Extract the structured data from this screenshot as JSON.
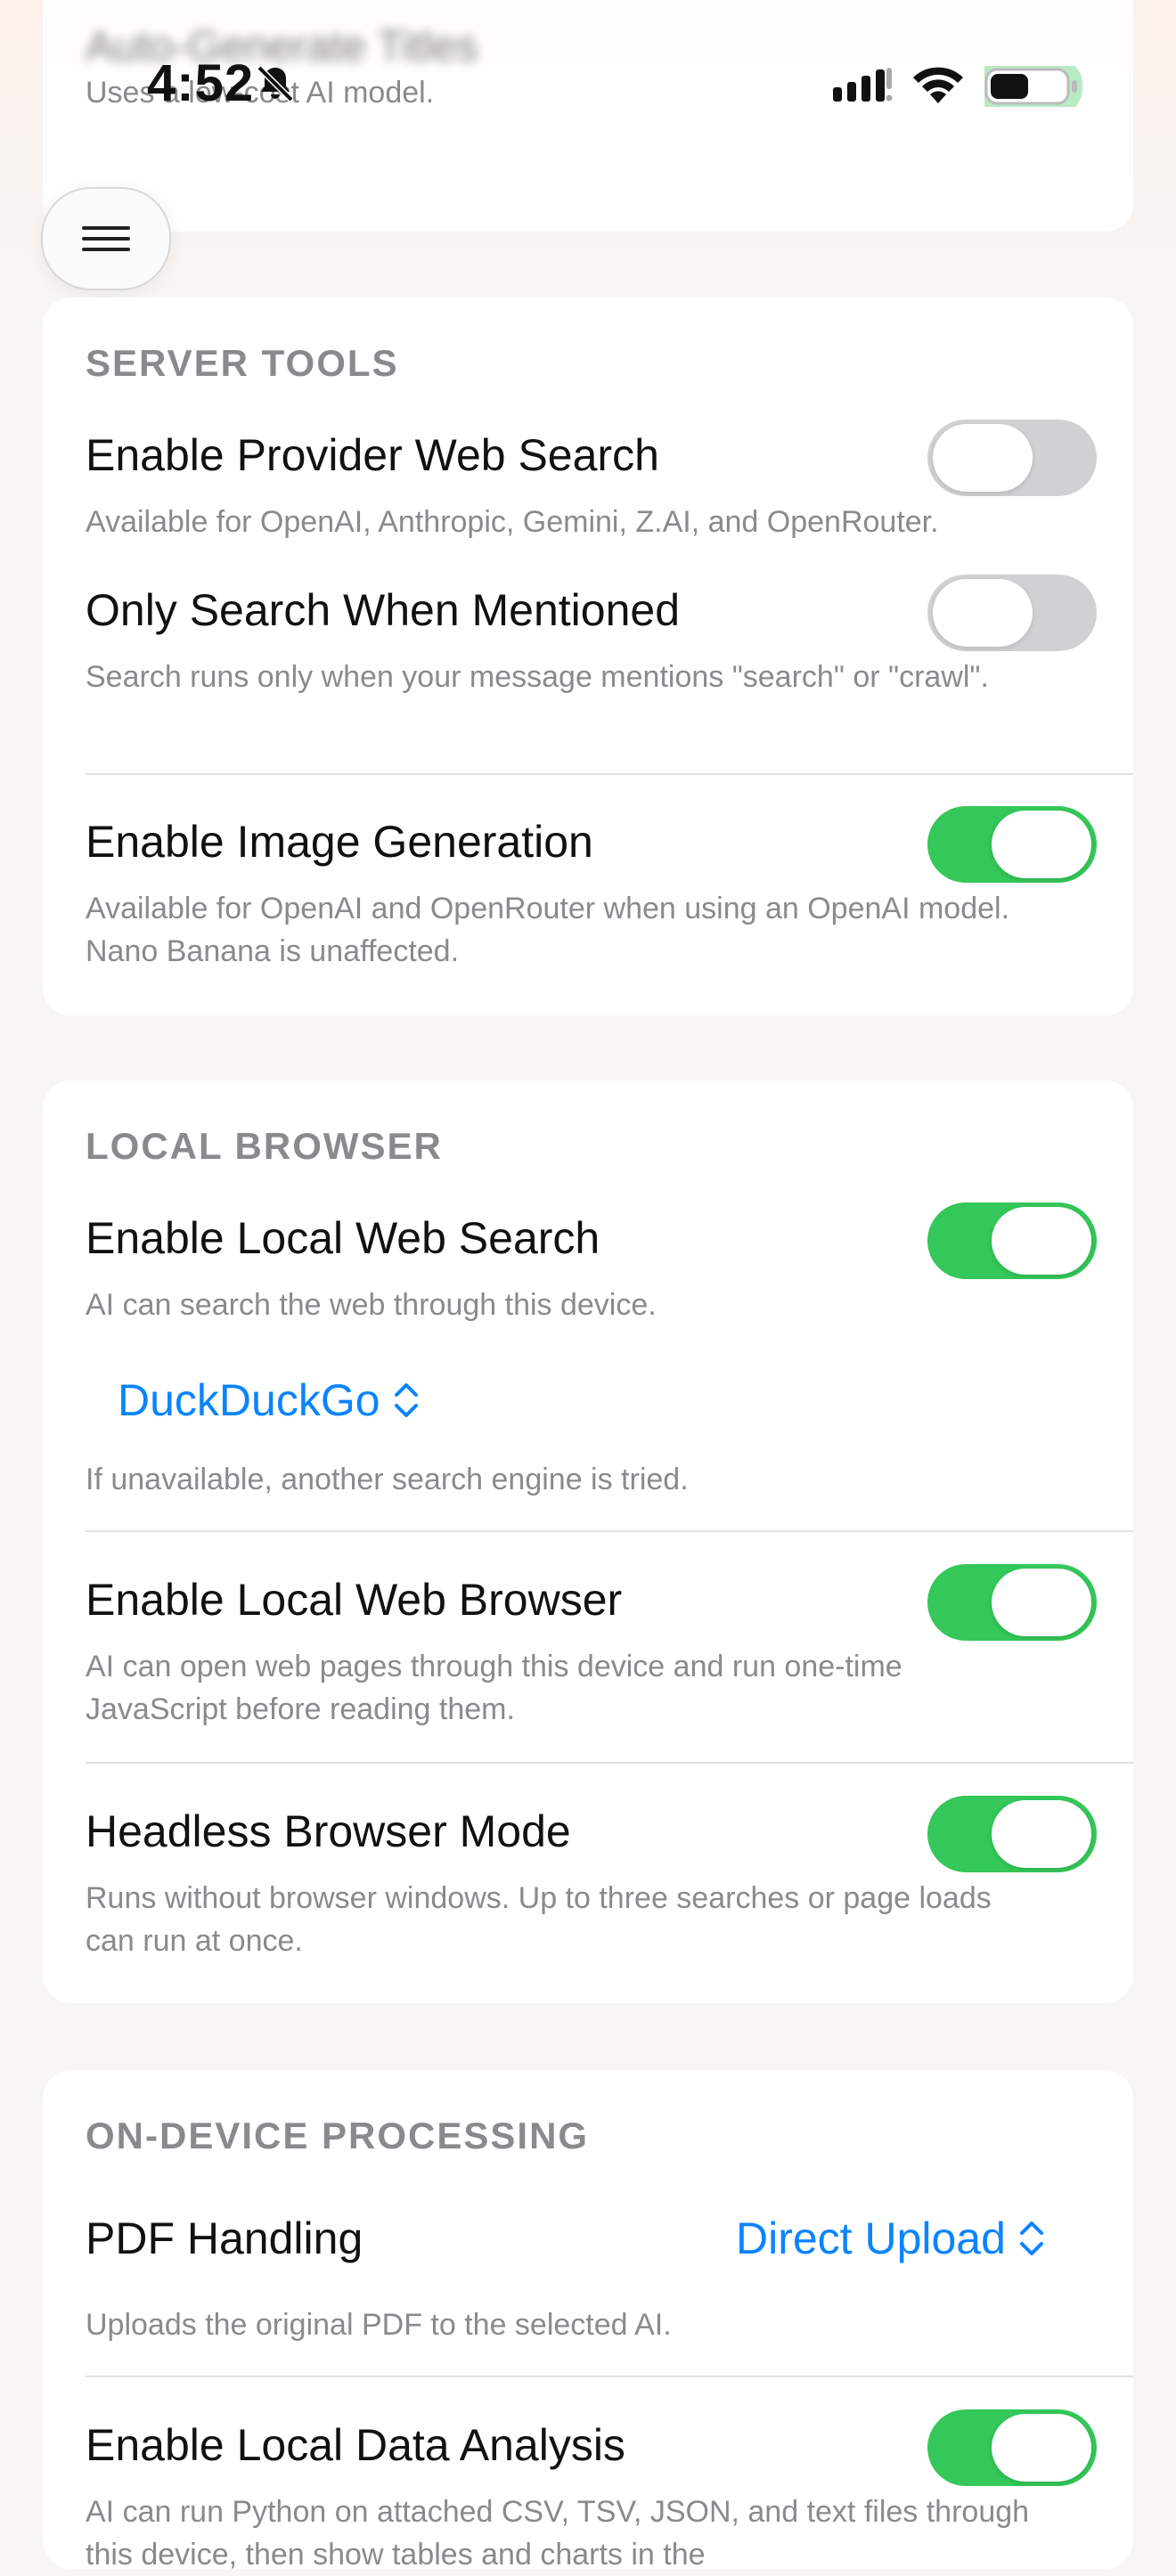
{
  "status_bar": {
    "time": "4:52"
  },
  "top_card": {
    "title": "Auto-Generate Titles",
    "note": "Uses a low-cost AI model."
  },
  "server_tools": {
    "title": "SERVER TOOLS",
    "rows": [
      {
        "title": "Enable Provider Web Search",
        "desc": "Available for OpenAI, Anthropic, Gemini, Z.AI, and OpenRouter.",
        "on": false
      },
      {
        "title": "Only Search When Mentioned",
        "desc": "Search runs only when your message mentions \"search\" or \"crawl\".",
        "on": false
      },
      {
        "title": "Enable Image Generation",
        "desc": "Available for OpenAI and OpenRouter when using an OpenAI model. Nano Banana is unaffected.",
        "on": true
      }
    ]
  },
  "local_browser": {
    "title": "LOCAL BROWSER",
    "search": {
      "title": "Enable Local Web Search",
      "desc": "AI can search the web through this device.",
      "on": true
    },
    "engine_picker": "DuckDuckGo",
    "engine_note": "If unavailable, another search engine is tried.",
    "browser": {
      "title": "Enable Local Web Browser",
      "desc": "AI can open web pages through this device and run one-time JavaScript before reading them.",
      "on": true
    },
    "headless": {
      "title": "Headless Browser Mode",
      "desc": "Runs without browser windows. Up to three searches or page loads can run at once.",
      "on": true
    }
  },
  "on_device": {
    "title": "ON-DEVICE PROCESSING",
    "pdf_label": "PDF Handling",
    "pdf_value": "Direct Upload",
    "pdf_note": "Uploads the original PDF to the selected AI.",
    "analysis": {
      "title": "Enable Local Data Analysis",
      "desc": "AI can run Python on attached CSV, TSV, JSON, and text files through this device, then show tables and charts in the",
      "on": true
    }
  },
  "colors": {
    "accent": "#0a84ff",
    "toggle_on": "#34c759",
    "toggle_off": "#d1d1d4"
  }
}
